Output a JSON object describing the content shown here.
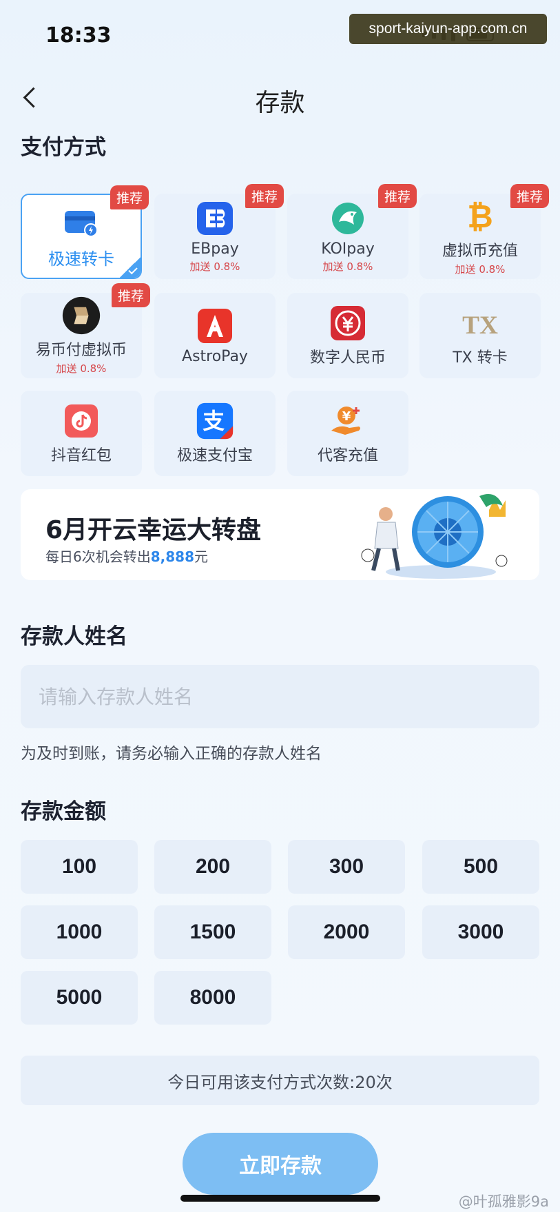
{
  "status": {
    "time": "18:33"
  },
  "watermark_top": "sport-kaiyun-app.com.cn",
  "nav": {
    "title": "存款"
  },
  "sections": {
    "payment": "支付方式",
    "depositor": "存款人姓名",
    "amount": "存款金额"
  },
  "payment_methods": [
    {
      "name": "极速转卡",
      "bonus": "",
      "badge": "推荐",
      "selected": true,
      "icon": "card-icon"
    },
    {
      "name": "EBpay",
      "bonus": "加送 0.8%",
      "badge": "推荐",
      "selected": false,
      "icon": "ebpay-icon"
    },
    {
      "name": "KOIpay",
      "bonus": "加送 0.8%",
      "badge": "推荐",
      "selected": false,
      "icon": "koi-icon"
    },
    {
      "name": "虚拟币充值",
      "bonus": "加送 0.8%",
      "badge": "推荐",
      "selected": false,
      "icon": "bitcoin-icon"
    },
    {
      "name": "易币付虚拟币",
      "bonus": "加送 0.8%",
      "badge": "推荐",
      "selected": false,
      "icon": "yibifu-icon"
    },
    {
      "name": "AstroPay",
      "bonus": "",
      "badge": "",
      "selected": false,
      "icon": "astropay-icon"
    },
    {
      "name": "数字人民币",
      "bonus": "",
      "badge": "",
      "selected": false,
      "icon": "ecny-icon"
    },
    {
      "name": "TX 转卡",
      "bonus": "",
      "badge": "",
      "selected": false,
      "icon": "tx-icon"
    },
    {
      "name": "抖音红包",
      "bonus": "",
      "badge": "",
      "selected": false,
      "icon": "douyin-redpacket-icon"
    },
    {
      "name": "极速支付宝",
      "bonus": "",
      "badge": "",
      "selected": false,
      "icon": "alipay-icon"
    },
    {
      "name": "代客充值",
      "bonus": "",
      "badge": "",
      "selected": false,
      "icon": "agent-recharge-icon"
    }
  ],
  "banner": {
    "title": "6月开云幸运大转盘",
    "sub_prefix": "每日6次机会转出",
    "sub_highlight": "8,888",
    "sub_suffix": "元"
  },
  "depositor": {
    "placeholder": "请输入存款人姓名",
    "hint": "为及时到账，请务必输入正确的存款人姓名"
  },
  "amounts": [
    "100",
    "200",
    "300",
    "500",
    "1000",
    "1500",
    "2000",
    "3000",
    "5000",
    "8000"
  ],
  "limit_text": "今日可用该支付方式次数:20次",
  "submit_label": "立即存款",
  "watermark_bottom": "@叶孤雅影9a",
  "colors": {
    "accent": "#4aa2f3",
    "badge": "#e24a44",
    "submit": "#7dbef3"
  }
}
